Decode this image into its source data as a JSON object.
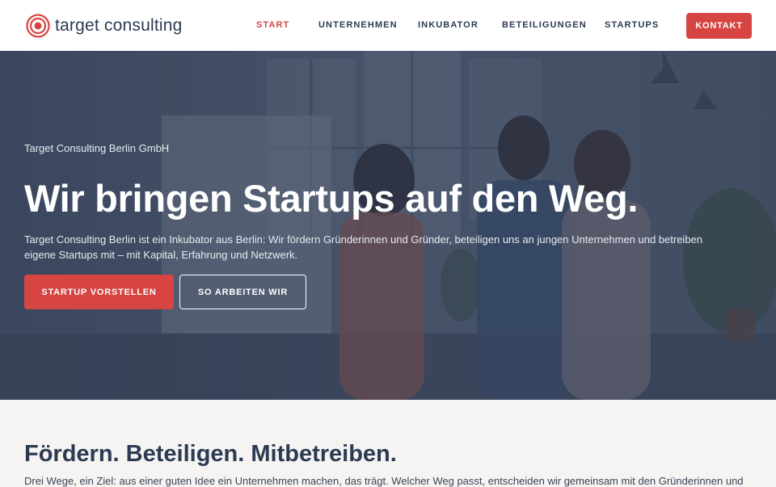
{
  "brand": {
    "name": "target consulting",
    "accent": "#d64541",
    "navy": "#2c3a52"
  },
  "nav": {
    "items": [
      {
        "label": "START",
        "active": true
      },
      {
        "label": "UNTERNEHMEN",
        "active": false
      },
      {
        "label": "INKUBATOR",
        "active": false
      },
      {
        "label": "BETEILIGUNGEN",
        "active": false
      },
      {
        "label": "STARTUPS",
        "active": false
      }
    ],
    "contact_label": "KONTAKT"
  },
  "hero": {
    "eyebrow": "Target Consulting Berlin GmbH",
    "title": "Wir bringen Startups auf den Weg.",
    "text": "Target Consulting Berlin ist ein Inkubator aus Berlin: Wir fördern Gründerinnen und Gründer, beteiligen uns an jungen Unternehmen und betreiben eigene Startups mit – mit Kapital, Erfahrung und Netzwerk.",
    "primary_button": "STARTUP VORSTELLEN",
    "secondary_button": "SO ARBEITEN WIR"
  },
  "section": {
    "title": "Fördern. Beteiligen. Mitbetreiben.",
    "text": "Drei Wege, ein Ziel: aus einer guten Idee ein Unternehmen machen, das trägt. Welcher Weg passt, entscheiden wir gemeinsam mit den Gründerinnen und"
  }
}
